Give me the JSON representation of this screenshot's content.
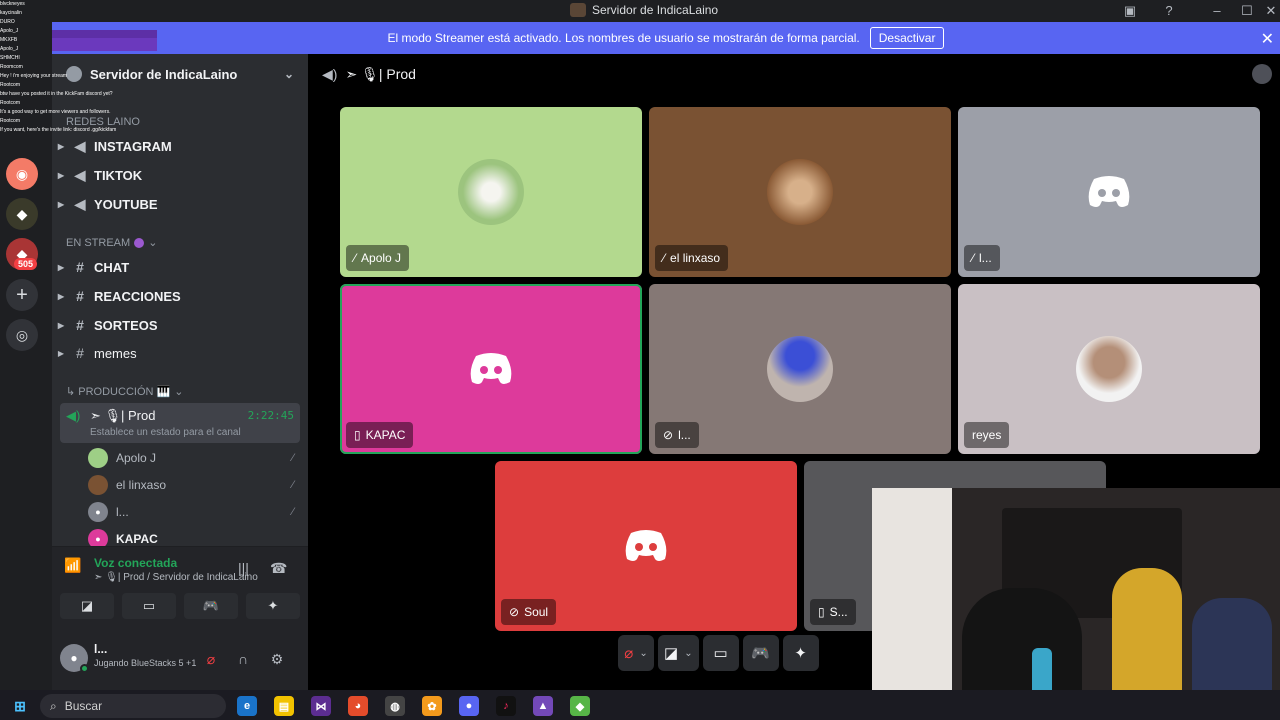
{
  "window": {
    "title": "Servidor de IndicaLaino"
  },
  "streamer_bar": {
    "message": "El modo Streamer está activado. Los nombres de usuario se mostrarán de forma parcial.",
    "button": "Desactivar"
  },
  "colors": {
    "accent": "#5865f2",
    "online": "#23a559",
    "danger": "#f23f43",
    "sidebar": "#2b2d31"
  },
  "server_list": {
    "badge": "505"
  },
  "sidebar": {
    "server_name": "Servidor de IndicaLaino",
    "category_redes": "REDES LAINO",
    "channels_redes": [
      "INSTAGRAM",
      "TIKTOK",
      "YOUTUBE"
    ],
    "category_stream": "EN STREAM",
    "channels_stream": [
      "CHAT",
      "REACCIONES",
      "SORTEOS",
      "memes"
    ],
    "category_produccion": "↳ PRODUCCIÓN 🎹",
    "active_channel": {
      "name": "➣ 🎙| Prod",
      "timer": "2:22:45",
      "status": "Establece un estado para el canal"
    },
    "voice_users": [
      "Apolo J",
      "el linxaso",
      "l...",
      "KAPAC"
    ]
  },
  "voice_panel": {
    "status": "Voz conectada",
    "subtitle": "➣ 🎙| Prod / Servidor de IndicaLaino"
  },
  "user_panel": {
    "name": "l...",
    "activity": "Jugando BlueStacks 5 +1"
  },
  "main": {
    "channel_title": "➣ 🎙| Prod"
  },
  "tiles": [
    {
      "label": "Apolo J",
      "bg": "#b3d98e"
    },
    {
      "label": "el linxaso",
      "bg": "#7a5233"
    },
    {
      "label": "l...",
      "bg": "#9c9fa8"
    },
    {
      "label": "KAPAC",
      "bg": "#dd3a9b"
    },
    {
      "label": "l...",
      "bg": "#857875"
    },
    {
      "label": "reyes",
      "bg": "#c9c0c4"
    },
    {
      "label": "Soul",
      "bg": "#dd3d3d"
    },
    {
      "label": "S...",
      "bg": "#57575a"
    }
  ],
  "taskbar": {
    "search_placeholder": "Buscar"
  },
  "chat_overlay": [
    "blvckneyes",
    "kaycinalin",
    "DURO",
    "Apolo_J",
    "MKXFB",
    "Apolo_J",
    "SHMCHI",
    "Roomcom",
    "Hey ! i'm enjoying your stream",
    "Rootcom",
    "btw have you posted it in the KickFam discord yet?",
    "Rootcom",
    "It's a good way to get more viewers and followers.",
    "Rootcom",
    "If you want, here's the invite link: discord .gg/kickfam"
  ]
}
